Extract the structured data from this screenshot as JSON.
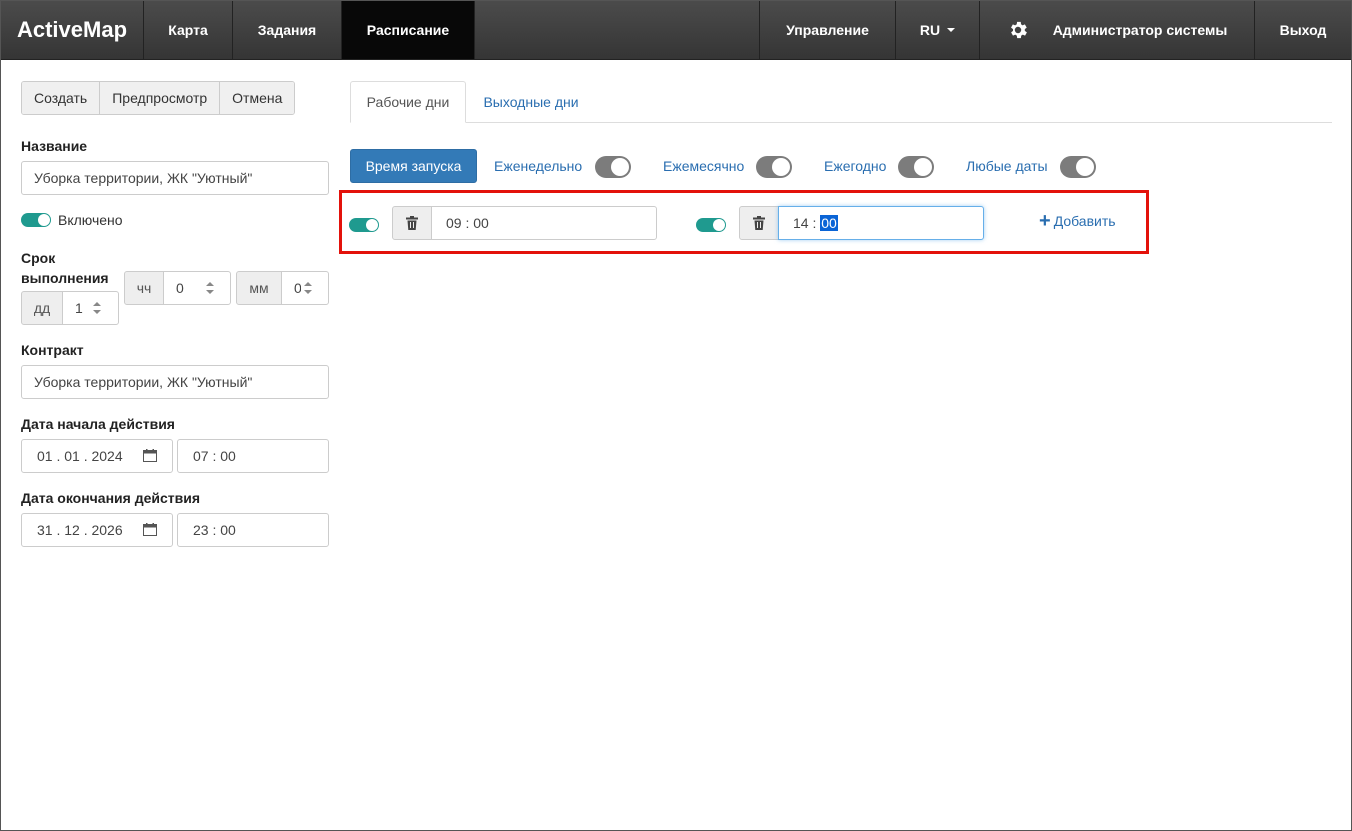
{
  "navbar": {
    "brand": "ActiveMap",
    "items": [
      "Карта",
      "Задания",
      "Расписание"
    ],
    "right": {
      "manage": "Управление",
      "lang": "RU",
      "user": "Администратор системы",
      "logout": "Выход"
    }
  },
  "toolbar": {
    "create": "Создать",
    "preview": "Предпросмотр",
    "cancel": "Отмена"
  },
  "form": {
    "name_label": "Название",
    "name_value": "Уборка территории, ЖК \"Уютный\"",
    "enabled_label": "Включено",
    "duration_label": "Срок выполнения",
    "duration_label_line1": "Срок",
    "duration_label_line2": "выполнения",
    "hours_unit": "чч",
    "hours_value": "0",
    "minutes_unit": "мм",
    "minutes_value": "0",
    "days_unit": "дд",
    "days_value": "1",
    "contract_label": "Контракт",
    "contract_value": "Уборка территории, ЖК \"Уютный\"",
    "start_label": "Дата начала действия",
    "start_date": "01 . 01 . 2024",
    "start_time": "07 : 00",
    "end_label": "Дата окончания действия",
    "end_date": "31 . 12 . 2026",
    "end_time": "23 : 00"
  },
  "tabs": {
    "workdays": "Рабочие дни",
    "weekends": "Выходные дни"
  },
  "schedule": {
    "launch_time": "Время запуска",
    "weekly": "Еженедельно",
    "monthly": "Ежемесячно",
    "yearly": "Ежегодно",
    "any_dates": "Любые даты",
    "time1": "09 : 00",
    "time2_hours": "14",
    "time2_sep": " : ",
    "time2_minutes": "00",
    "add": "Добавить"
  },
  "colors": {
    "navbar": "#3f3f3f",
    "active_nav": "#080808",
    "toggle_on": "#1f9a8f",
    "toggle_off": "#7c7c7c",
    "primary": "#337ab7",
    "link": "#2a6eb0",
    "highlight": "#e3120b"
  }
}
